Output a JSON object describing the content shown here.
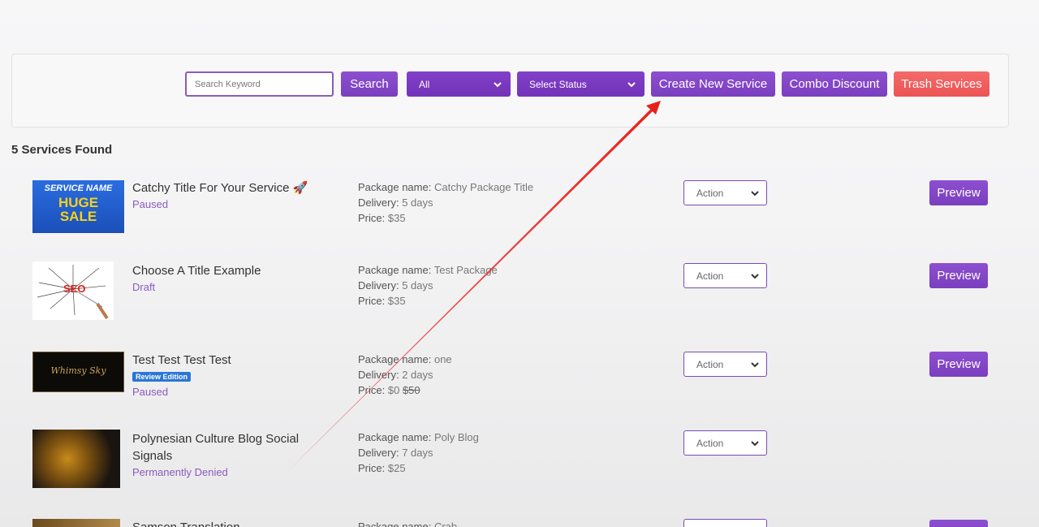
{
  "toolbar": {
    "search_placeholder": "Search Keyword",
    "search_label": "Search",
    "category_select": "All",
    "status_select": "Select Status",
    "create_label": "Create New Service",
    "combo_label": "Combo Discount",
    "trash_label": "Trash Services"
  },
  "results_count": "5 Services Found",
  "labels": {
    "package_name": "Package name:",
    "delivery": "Delivery:",
    "price": "Price:",
    "action": "Action",
    "preview": "Preview"
  },
  "services": [
    {
      "title": "Catchy Title For Your Service 🚀",
      "status": "Paused",
      "thumb_line1": "SERVICE NAME",
      "thumb_line2": "HUGE",
      "thumb_line3": "SALE",
      "package": "Catchy Package Title",
      "delivery": "5 days",
      "price": "$35"
    },
    {
      "title": "Choose A Title Example",
      "status": "Draft",
      "thumb_line1": "SEO",
      "package": "Test Package",
      "delivery": "5 days",
      "price": "$35"
    },
    {
      "title": "Test Test Test Test",
      "badge": "Review Edition",
      "status": "Paused",
      "thumb_line1": "Whimsy Sky",
      "package": "one",
      "delivery": "2 days",
      "price": "$0",
      "price_old": "$50"
    },
    {
      "title": "Polynesian Culture Blog Social Signals",
      "status": "Permanently Denied",
      "package": "Poly Blog",
      "delivery": "7 days",
      "price": "$25"
    },
    {
      "title": "Samson Translation",
      "package": "Crab"
    }
  ],
  "colors": {
    "accent": "#7a3fbe",
    "danger": "#ec5353",
    "status": "#8a5bbd",
    "badge": "#2a76d6",
    "annotation_arrow": "#e8201c"
  }
}
